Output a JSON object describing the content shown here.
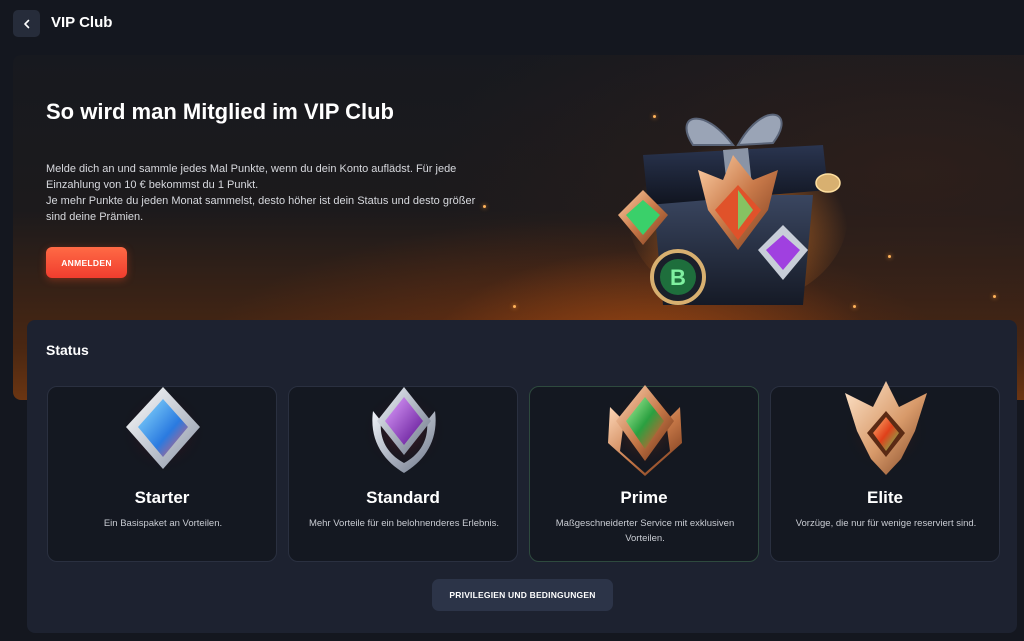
{
  "header": {
    "title": "VIP Club",
    "back_icon": "chevron-left-icon"
  },
  "hero": {
    "title": "So wird man Mitglied im VIP Club",
    "paragraph_1": "Melde dich an und sammle jedes Mal Punkte, wenn du dein Konto auflädst. Für jede Einzahlung von 10 € bekommst du 1 Punkt.",
    "paragraph_2": "Je mehr Punkte du jeden Monat sammelst, desto höher ist dein Status und desto größer sind deine Prämien.",
    "signup_label": "ANMELDEN",
    "image": "vip-gift-box-with-badges",
    "chip_letter": "B"
  },
  "status": {
    "title": "Status",
    "levels": [
      {
        "name": "Starter",
        "description": "Ein Basispaket an Vorteilen.",
        "badge": "blue-diamond-badge-icon",
        "gem_color": "#4aa8ff",
        "frame_color": "#c9d3e3"
      },
      {
        "name": "Standard",
        "description": "Mehr Vorteile für ein belohnenderes Erlebnis.",
        "badge": "purple-diamond-badge-icon",
        "gem_color": "#a040e0",
        "frame_color": "#b8c0cc"
      },
      {
        "name": "Prime",
        "description": "Maßgeschneiderter Service mit exklusiven Vorteilen.",
        "badge": "green-diamond-badge-icon",
        "gem_color": "#3fd06a",
        "frame_color": "#d38a5c"
      },
      {
        "name": "Elite",
        "description": "Vorzüge, die nur für wenige reserviert sind.",
        "badge": "orange-crown-badge-icon",
        "gem_color": "#f06a1e",
        "frame_color": "#e0b088"
      }
    ],
    "privileges_label": "PRIVILEGIEN UND BEDINGUNGEN"
  },
  "colors": {
    "background": "#14171f",
    "panel": "#1d2230",
    "card": "#141821",
    "accent_start": "#ff6a45",
    "accent_end": "#f03d2e"
  }
}
